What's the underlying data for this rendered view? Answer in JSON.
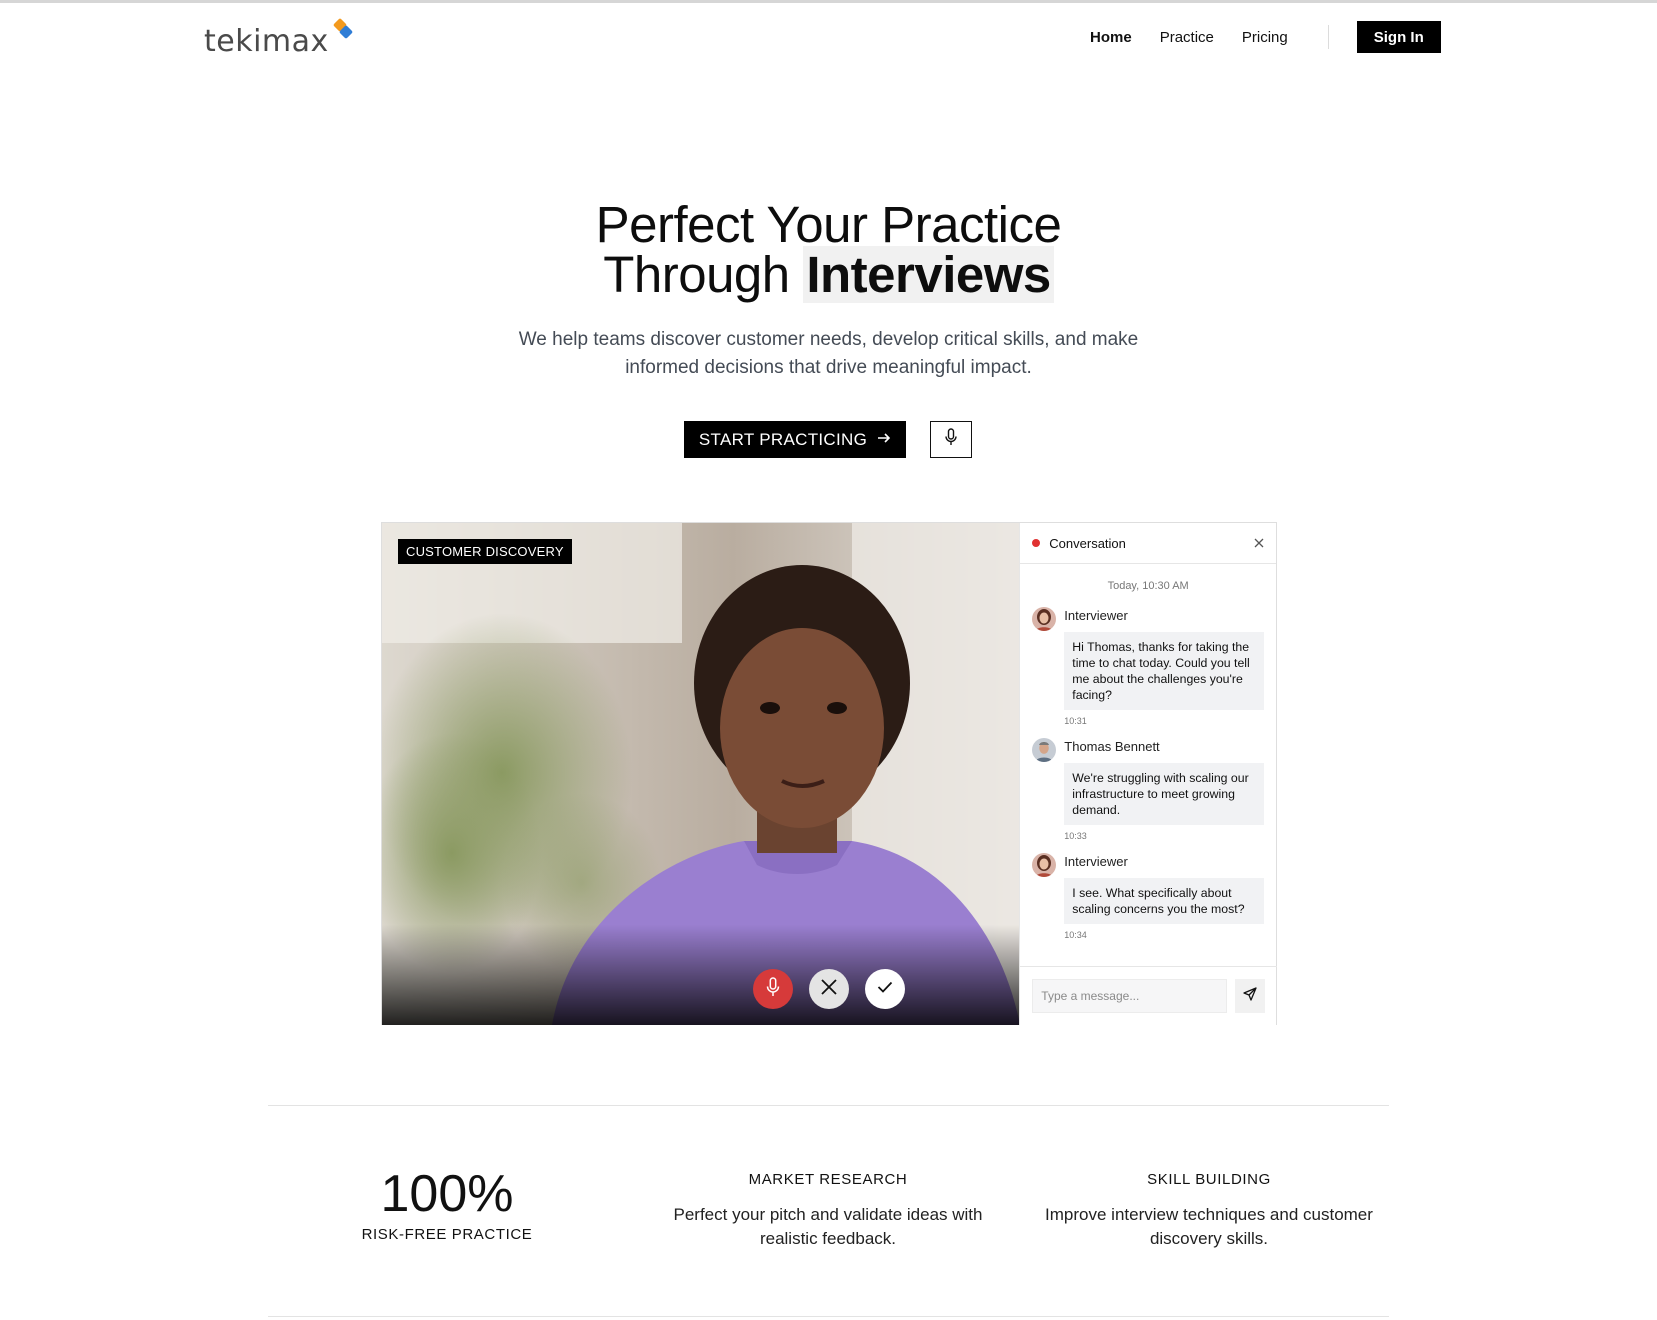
{
  "header": {
    "logo_text": "tekimax",
    "nav": [
      {
        "label": "Home",
        "active": true
      },
      {
        "label": "Practice",
        "active": false
      },
      {
        "label": "Pricing",
        "active": false
      }
    ],
    "signin_label": "Sign In"
  },
  "hero": {
    "title_line1": "Perfect Your Practice",
    "title_line2_plain": "Through ",
    "title_line2_bold": "Interviews",
    "subtitle": "We help teams discover customer needs, develop critical skills, and make informed decisions that drive meaningful impact.",
    "cta_label": "START PRACTICING",
    "cta_icon": "arrow-right-icon",
    "mic_icon": "microphone-icon"
  },
  "demo": {
    "video_badge": "CUSTOMER DISCOVERY",
    "controls": [
      {
        "name": "mic-button",
        "icon": "microphone-icon",
        "color": "#d63a3a"
      },
      {
        "name": "end-button",
        "icon": "close-icon",
        "color": "#e4e4e4"
      },
      {
        "name": "confirm-button",
        "icon": "check-icon",
        "color": "#ffffff"
      }
    ],
    "chat": {
      "title": "Conversation",
      "status_color": "#e03131",
      "date": "Today, 10:30 AM",
      "messages": [
        {
          "sender": "Interviewer",
          "text": "Hi Thomas, thanks for taking the time to chat today. Could you tell me about the challenges you're facing?",
          "time": "10:31"
        },
        {
          "sender": "Thomas Bennett",
          "text": "We're struggling with scaling our infrastructure to meet growing demand.",
          "time": "10:33"
        },
        {
          "sender": "Interviewer",
          "text": "I see. What specifically about scaling concerns you the most?",
          "time": "10:34"
        }
      ],
      "input_placeholder": "Type a message..."
    }
  },
  "stats": [
    {
      "big": "100%",
      "label": "RISK-FREE PRACTICE"
    },
    {
      "heading": "MARKET RESEARCH",
      "text": "Perfect your pitch and validate ideas with realistic feedback."
    },
    {
      "heading": "SKILL BUILDING",
      "text": "Improve interview techniques and customer discovery skills."
    }
  ]
}
